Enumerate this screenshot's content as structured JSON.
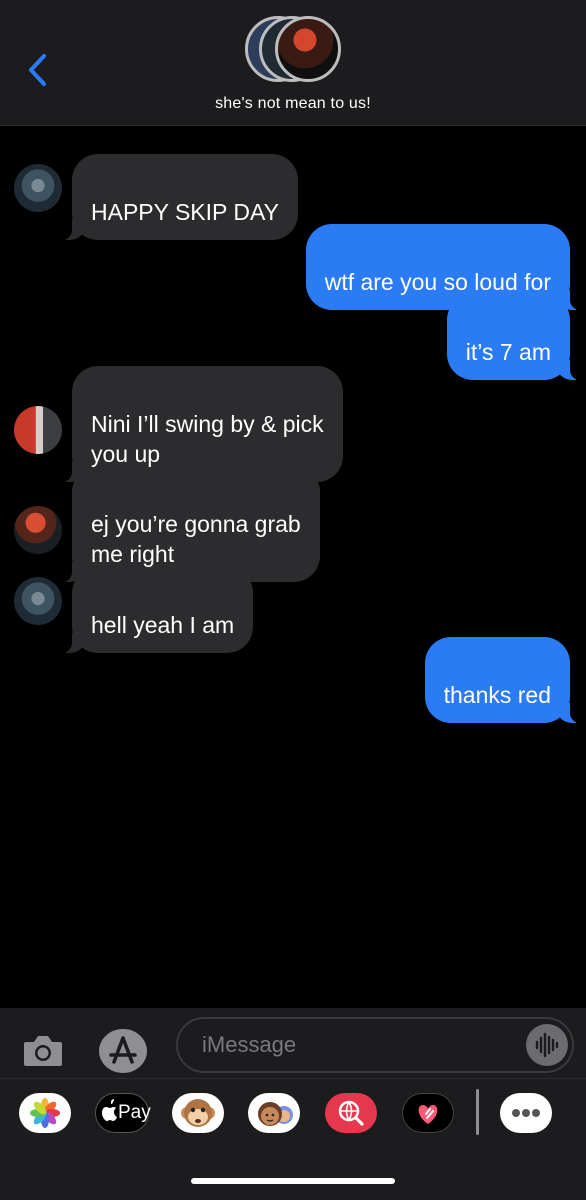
{
  "header": {
    "group_name": "she's not mean to us!",
    "back_icon": "chevron-left-icon"
  },
  "messages": [
    {
      "direction": "incoming",
      "sender_avatar": "avatar-a",
      "text": "HAPPY SKIP DAY"
    },
    {
      "direction": "outgoing",
      "text": "wtf are you so loud for"
    },
    {
      "direction": "outgoing",
      "text": "it’s 7 am"
    },
    {
      "direction": "incoming",
      "sender_avatar": "avatar-b",
      "text": "Nini I’ll swing by & pick\nyou up"
    },
    {
      "direction": "incoming",
      "sender_avatar": "avatar-c",
      "text": "ej you’re gonna grab\nme right"
    },
    {
      "direction": "incoming",
      "sender_avatar": "avatar-a",
      "text": "hell yeah I am"
    },
    {
      "direction": "outgoing",
      "text": "thanks red"
    }
  ],
  "composer": {
    "placeholder": "iMessage",
    "camera_icon": "camera-icon",
    "apps_icon": "app-store-icon",
    "audio_icon": "audio-waveform-icon"
  },
  "drawer": {
    "apps": [
      {
        "name": "photos-app-icon"
      },
      {
        "name": "apple-pay-app-icon",
        "label": "Pay"
      },
      {
        "name": "animoji-app-icon"
      },
      {
        "name": "memoji-stickers-app-icon"
      },
      {
        "name": "web-images-search-app-icon"
      },
      {
        "name": "digital-touch-app-icon"
      },
      {
        "name": "more-apps-icon"
      }
    ]
  },
  "colors": {
    "outgoing_bubble": "#2a7bf4",
    "incoming_bubble": "#2c2c2e",
    "accent": "#2a7bf4",
    "background": "#000000"
  }
}
